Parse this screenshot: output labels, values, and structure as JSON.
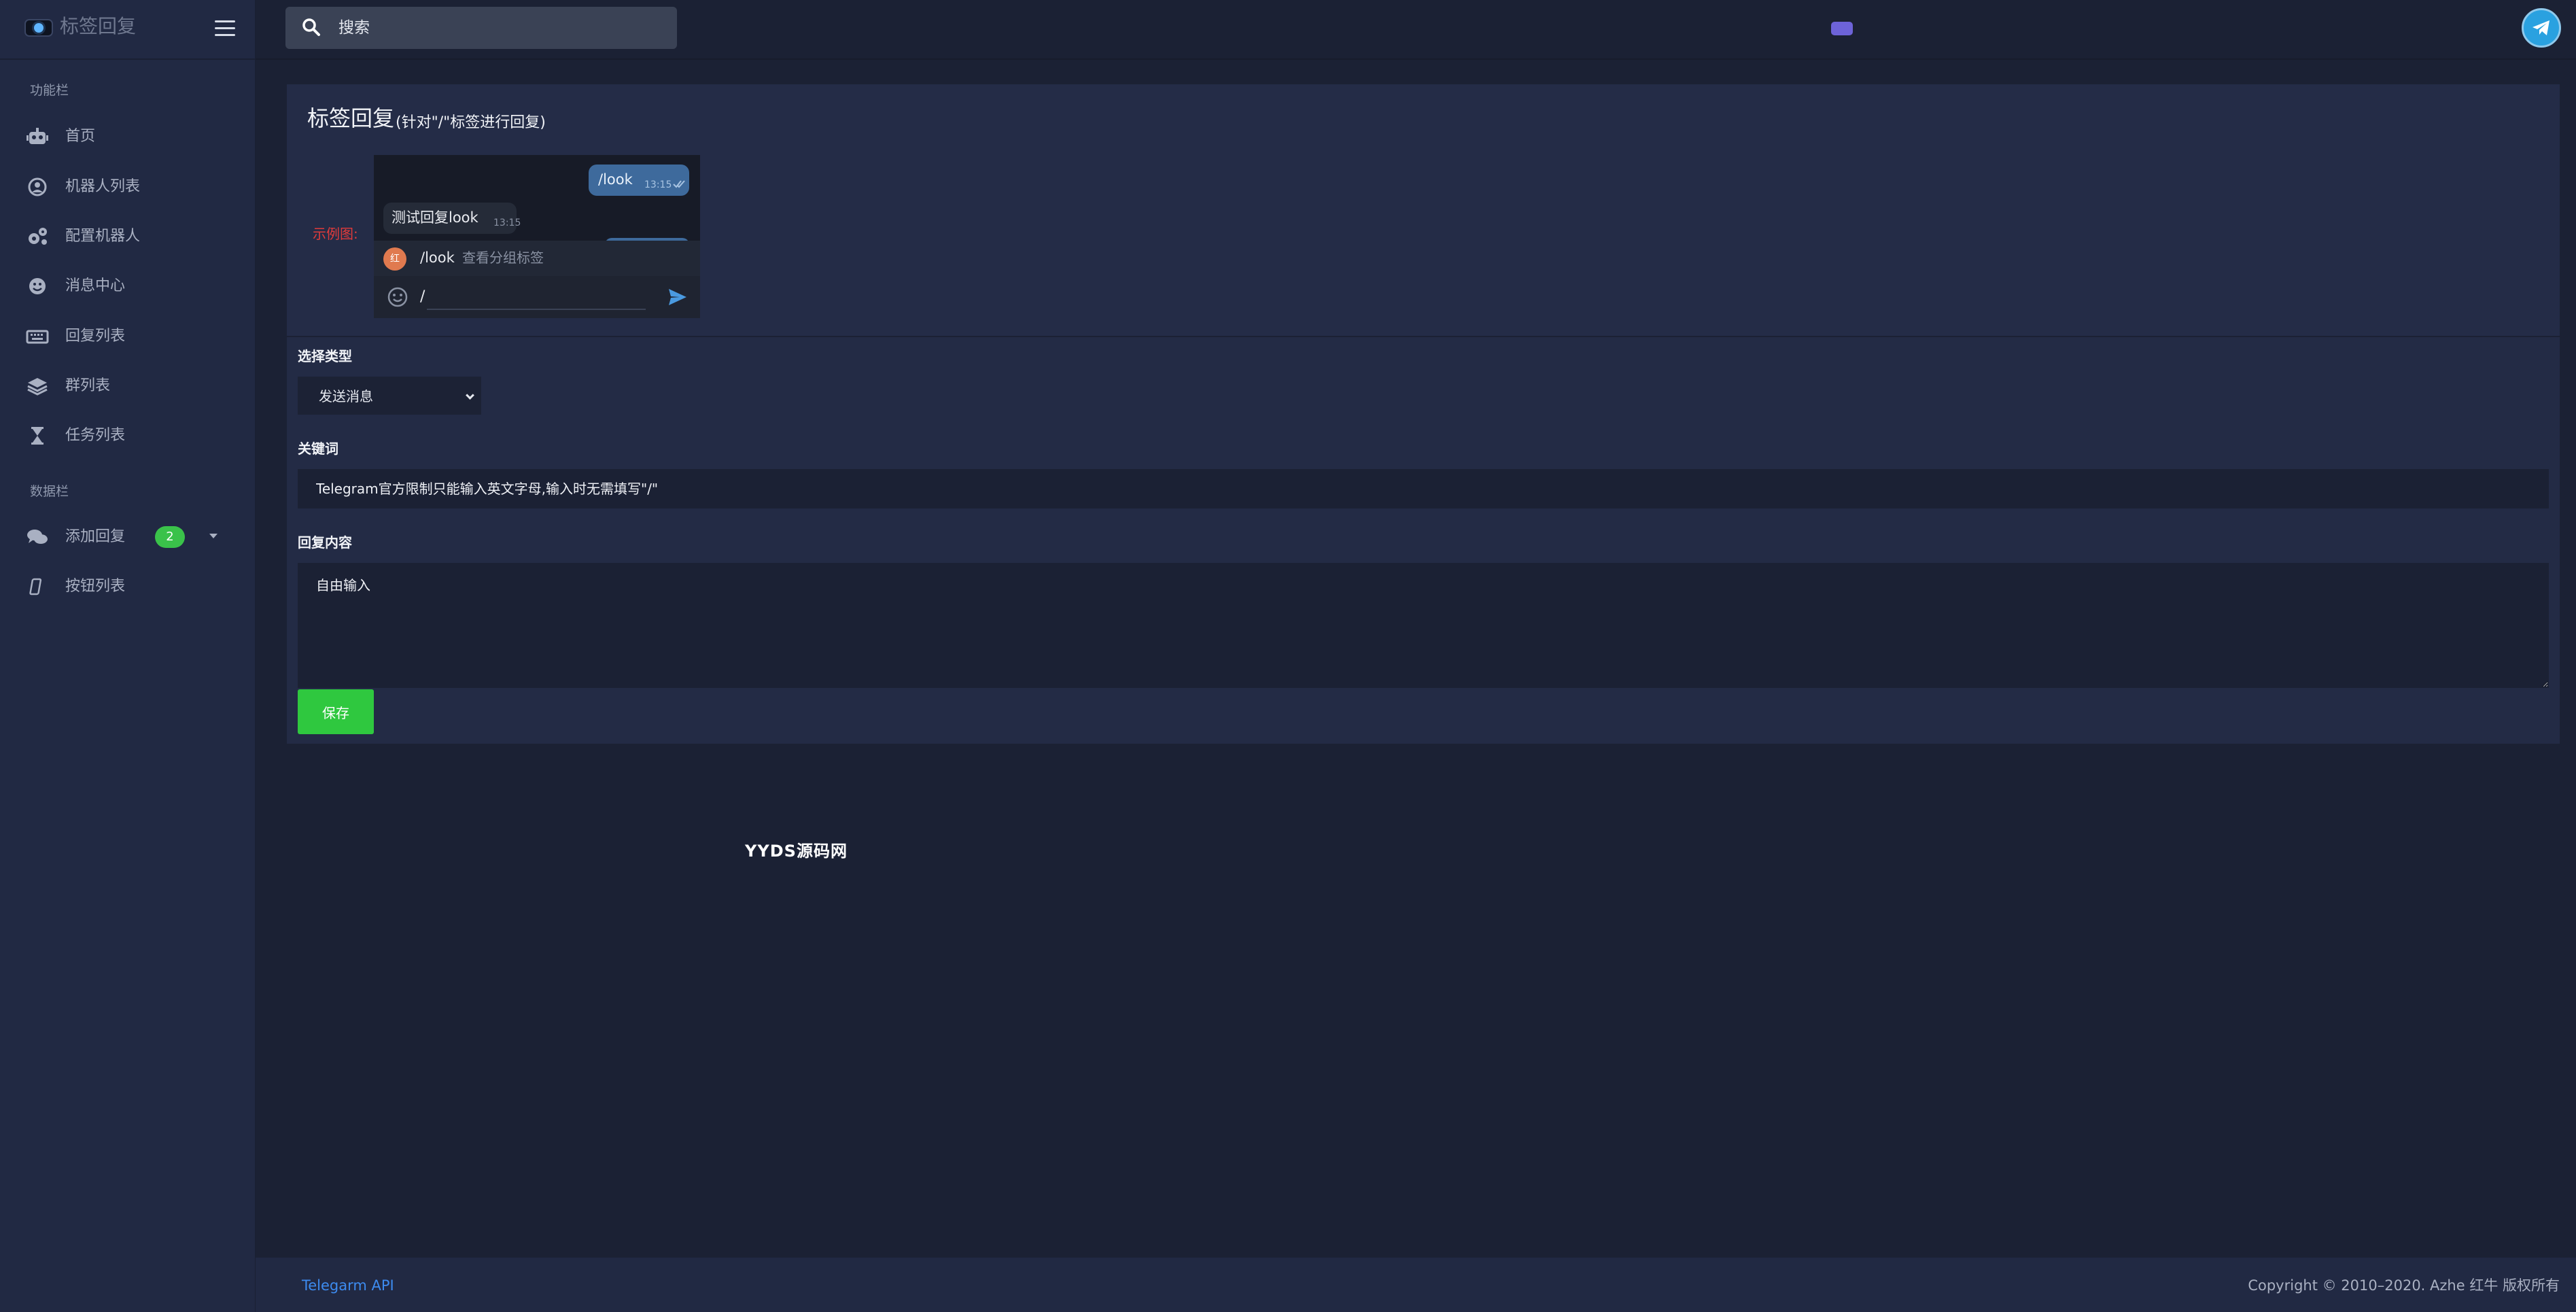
{
  "app": {
    "title": "标签回复"
  },
  "sidebar": {
    "sections": [
      {
        "label": "功能栏",
        "items": [
          {
            "label": "首页",
            "icon": "robot-icon"
          },
          {
            "label": "机器人列表",
            "icon": "user-circle-icon"
          },
          {
            "label": "配置机器人",
            "icon": "gears-icon"
          },
          {
            "label": "消息中心",
            "icon": "smile-icon"
          },
          {
            "label": "回复列表",
            "icon": "keyboard-icon"
          },
          {
            "label": "群列表",
            "icon": "layers-icon"
          },
          {
            "label": "任务列表",
            "icon": "hourglass-icon"
          }
        ]
      },
      {
        "label": "数据栏",
        "items": [
          {
            "label": "添加回复",
            "icon": "comments-icon",
            "badge": "2"
          },
          {
            "label": "按钮列表",
            "icon": "mobile-icon"
          }
        ]
      }
    ]
  },
  "topbar": {
    "search_placeholder": "搜索"
  },
  "card": {
    "title": "标签回复",
    "subtitle": "(针对\"/\"标签进行回复)",
    "example_label": "示例图:",
    "example_chat": {
      "out_message": "/look",
      "out_time": "13:15",
      "in_message": "测试回复look",
      "in_time": "13:15",
      "command_avatar": "红",
      "command_name": "/look",
      "command_desc": "查看分组标签",
      "compose_text": "/"
    }
  },
  "form": {
    "type_label": "选择类型",
    "type_selected": "发送消息",
    "keyword_label": "关键词",
    "keyword_placeholder": "Telegram官方限制只能输入英文字母,输入时无需填写\"/\"",
    "reply_label": "回复内容",
    "reply_placeholder": "自由输入",
    "save_label": "保存"
  },
  "watermark": "YYDS源码网",
  "footer": {
    "link": "Telegarm API",
    "copyright": "Copyright © 2010–2020. Azhe 红牛 版权所有"
  },
  "colors": {
    "background": "#1b2134",
    "sidebar": "#212943",
    "accent_green": "#2fc83f",
    "link_blue": "#3d8bef",
    "example_red": "#e03b3b"
  }
}
